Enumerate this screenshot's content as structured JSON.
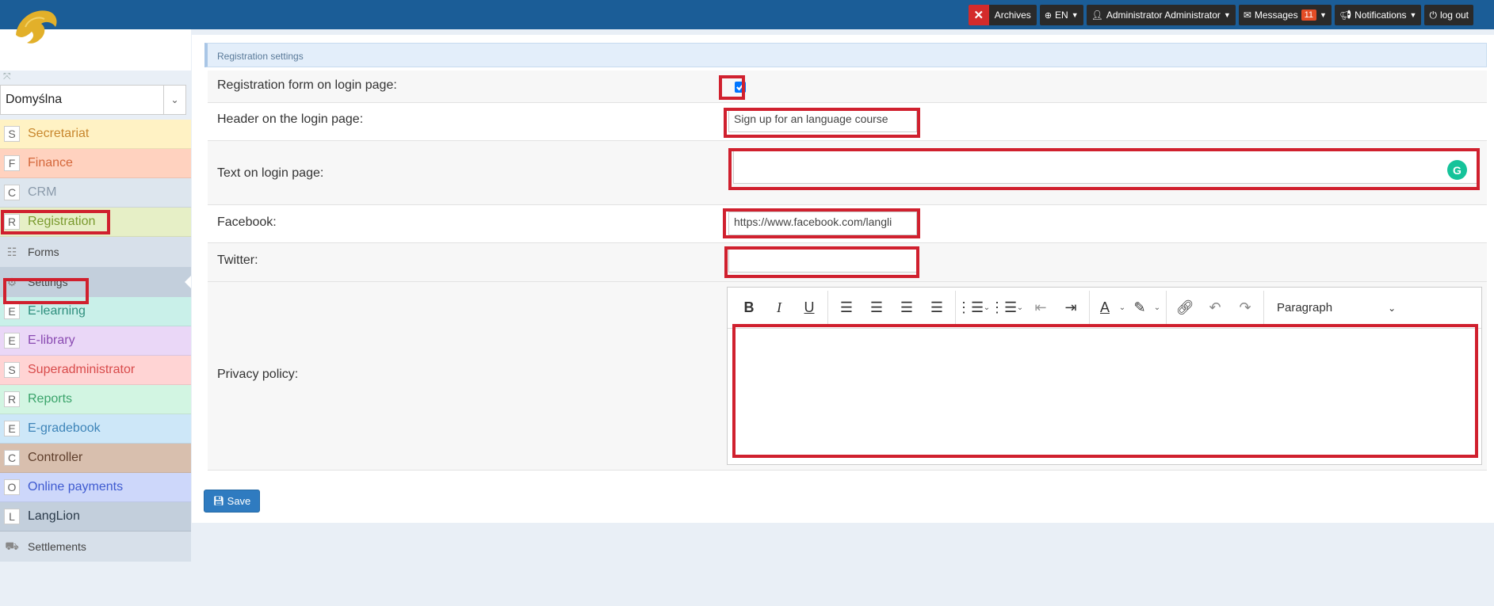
{
  "app": {
    "brand": "LangLion"
  },
  "topbar": {
    "archives": "Archives",
    "language": "EN",
    "user": "Administrator Administrator",
    "messages": "Messages",
    "messages_count": "11",
    "notifications": "Notifications",
    "logout": "log out"
  },
  "sidebar": {
    "select_value": "Domyślna",
    "items": [
      {
        "letter": "S",
        "label": "Secretariat",
        "bg": "#fff2c4",
        "color": "#c8872e"
      },
      {
        "letter": "F",
        "label": "Finance",
        "bg": "#ffd2bf",
        "color": "#d4673a"
      },
      {
        "letter": "C",
        "label": "CRM",
        "bg": "#dde6ee",
        "color": "#8a9aaa"
      },
      {
        "letter": "R",
        "label": "Registration",
        "bg": "#e6efc6",
        "color": "#7a9a2e"
      }
    ],
    "subs_registration": [
      {
        "icon": "☷",
        "label": "Forms"
      },
      {
        "icon": "⚙",
        "label": "Settings"
      }
    ],
    "items2": [
      {
        "letter": "E",
        "label": "E-learning",
        "bg": "#c9f0e9",
        "color": "#2f8f7e"
      },
      {
        "letter": "E",
        "label": "E-library",
        "bg": "#ead7f7",
        "color": "#8a4bb2"
      },
      {
        "letter": "S",
        "label": "Superadministrator",
        "bg": "#ffd4d4",
        "color": "#d84b4b"
      },
      {
        "letter": "R",
        "label": "Reports",
        "bg": "#d2f5e2",
        "color": "#3aa36a"
      },
      {
        "letter": "E",
        "label": "E-gradebook",
        "bg": "#cde7f8",
        "color": "#3d84b8"
      },
      {
        "letter": "C",
        "label": "Controller",
        "bg": "#d8bfae",
        "color": "#5e3e2b"
      },
      {
        "letter": "O",
        "label": "Online payments",
        "bg": "#cdd7fa",
        "color": "#3e5ad0"
      },
      {
        "letter": "L",
        "label": "LangLion",
        "bg": "#c3cfdc",
        "color": "#2a3a4a"
      }
    ],
    "subs_langlion": [
      {
        "icon": "⛟",
        "label": "Settlements"
      }
    ]
  },
  "panel": {
    "heading": "Registration settings",
    "rows": {
      "reg_form_label": "Registration form on login page:",
      "header_label": "Header on the login page:",
      "header_value": "Sign up for an language course",
      "text_label": "Text on login page:",
      "text_value": "",
      "facebook_label": "Facebook:",
      "facebook_value": "https://www.facebook.com/langli",
      "twitter_label": "Twitter:",
      "twitter_value": "",
      "privacy_label": "Privacy policy:"
    },
    "editor": {
      "paragraph": "Paragraph"
    },
    "save": "Save"
  }
}
